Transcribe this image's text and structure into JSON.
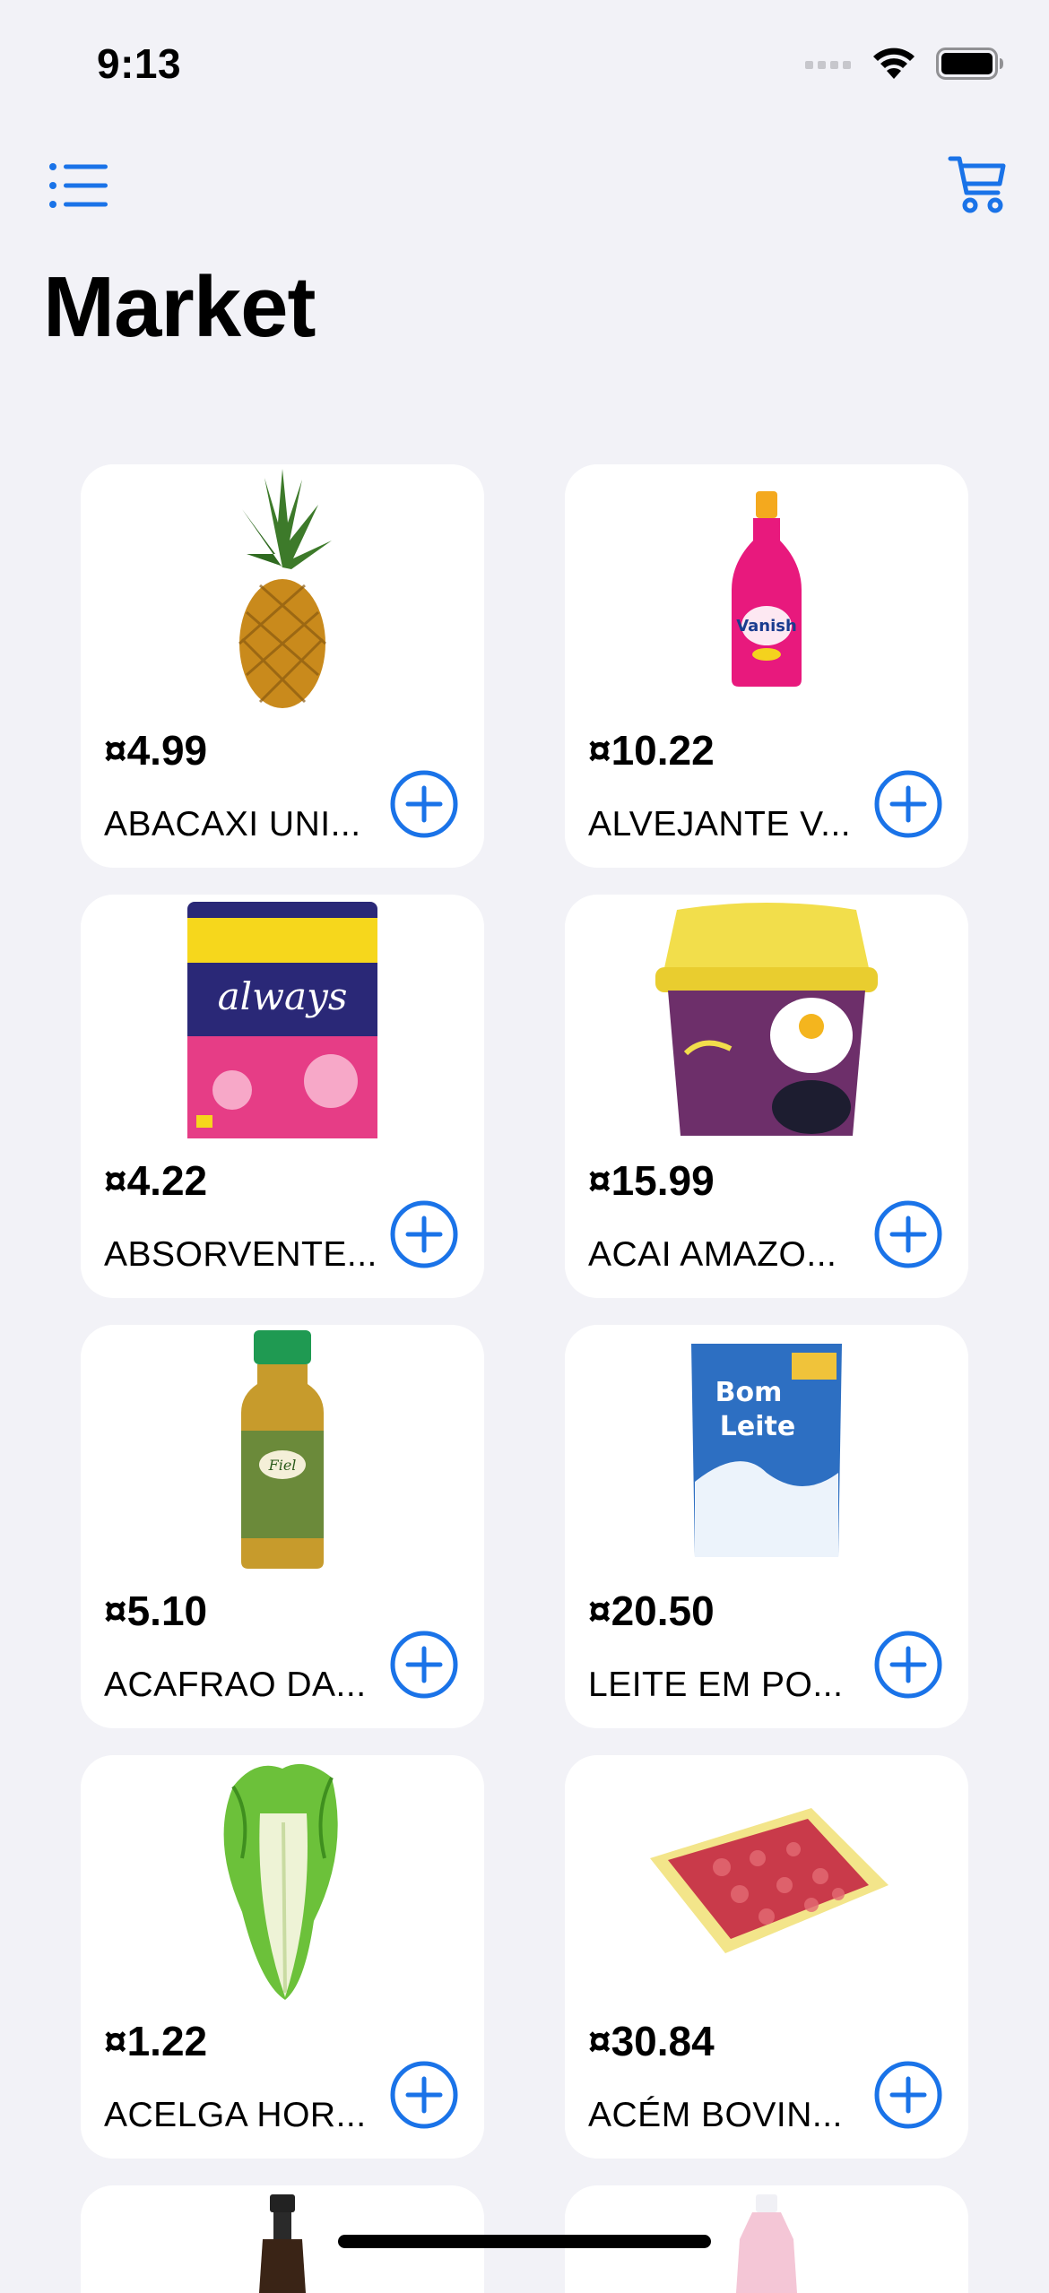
{
  "status_bar": {
    "time": "9:13"
  },
  "nav": {
    "menu_icon": "list-icon",
    "cart_icon": "cart-icon",
    "accent_color": "#1a73e8"
  },
  "title": "Market",
  "products": [
    {
      "price": "¤4.99",
      "name": "ABACAXI UNI...",
      "image": "pineapple"
    },
    {
      "price": "¤10.22",
      "name": "ALVEJANTE V...",
      "image": "vanish-bottle"
    },
    {
      "price": "¤4.22",
      "name": "ABSORVENTE...",
      "image": "always-pack"
    },
    {
      "price": "¤15.99",
      "name": "ACAI AMAZO...",
      "image": "acai-tub"
    },
    {
      "price": "¤5.10",
      "name": "ACAFRAO DA...",
      "image": "turmeric-bottle"
    },
    {
      "price": "¤20.50",
      "name": "LEITE EM PO...",
      "image": "milk-powder-bag"
    },
    {
      "price": "¤1.22",
      "name": "ACELGA HOR...",
      "image": "chard"
    },
    {
      "price": "¤30.84",
      "name": "ACÉM BOVIN...",
      "image": "ground-beef-tray"
    }
  ]
}
